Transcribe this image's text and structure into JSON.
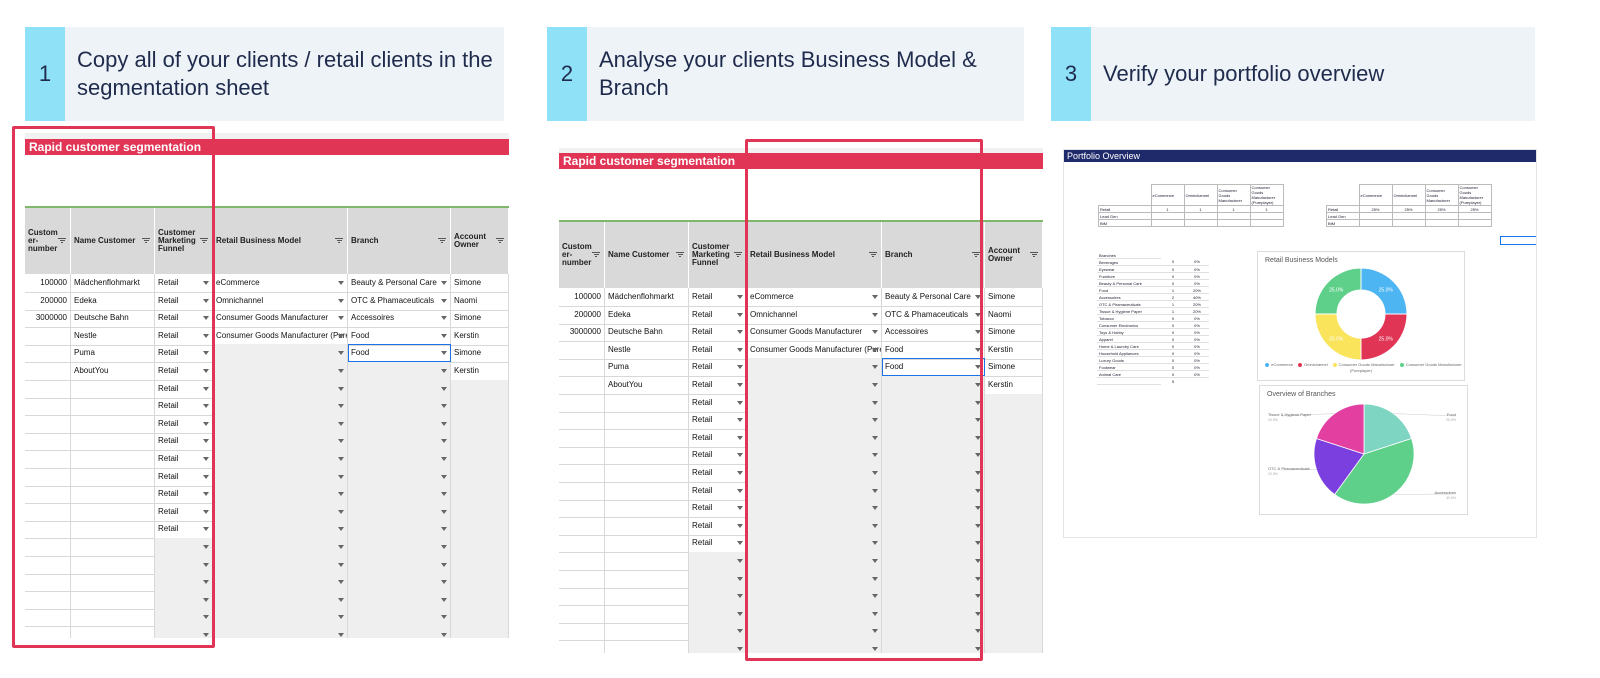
{
  "steps": [
    {
      "num": "1",
      "text": "Copy all of your clients / retail clients in the segmentation sheet"
    },
    {
      "num": "2",
      "text": "Analyse your clients Business Model & Branch"
    },
    {
      "num": "3",
      "text": "Verify your portfolio overview"
    }
  ],
  "sheet": {
    "title": "Rapid customer segmentation",
    "headers": [
      "Custom er- number",
      "Name Customer",
      "Customer Marketing Funnel",
      "Retail Business Model",
      "Branch",
      "Account Owner"
    ],
    "rows": [
      {
        "num": "100000",
        "name": "Mädchenflohmarkt",
        "funnel": "Retail",
        "model": "eCommerce",
        "branch": "Beauty & Personal Care",
        "owner": "Simone"
      },
      {
        "num": "200000",
        "name": "Edeka",
        "funnel": "Retail",
        "model": "Omnichannel",
        "branch": "OTC & Phamaceuticals",
        "owner": "Naomi"
      },
      {
        "num": "3000000",
        "name": "Deutsche  Bahn",
        "funnel": "Retail",
        "model": "Consumer Goods Manufacturer",
        "branch": "Accessoires",
        "owner": "Simone"
      },
      {
        "num": "",
        "name": "Nestle",
        "funnel": "Retail",
        "model": "Consumer Goods Manufacturer (Pureplayer)",
        "branch": "Food",
        "owner": "Kerstin"
      },
      {
        "num": "",
        "name": "Puma",
        "funnel": "Retail",
        "model": "",
        "branch": "Food",
        "owner": "Simone"
      },
      {
        "num": "",
        "name": "AboutYou",
        "funnel": "Retail",
        "model": "",
        "branch": "",
        "owner": "Kerstin"
      },
      {
        "num": "",
        "name": "",
        "funnel": "Retail",
        "model": "",
        "branch": "",
        "owner": ""
      },
      {
        "num": "",
        "name": "",
        "funnel": "Retail",
        "model": "",
        "branch": "",
        "owner": ""
      },
      {
        "num": "",
        "name": "",
        "funnel": "Retail",
        "model": "",
        "branch": "",
        "owner": ""
      },
      {
        "num": "",
        "name": "",
        "funnel": "Retail",
        "model": "",
        "branch": "",
        "owner": ""
      },
      {
        "num": "",
        "name": "",
        "funnel": "Retail",
        "model": "",
        "branch": "",
        "owner": ""
      },
      {
        "num": "",
        "name": "",
        "funnel": "Retail",
        "model": "",
        "branch": "",
        "owner": ""
      },
      {
        "num": "",
        "name": "",
        "funnel": "Retail",
        "model": "",
        "branch": "",
        "owner": ""
      },
      {
        "num": "",
        "name": "",
        "funnel": "Retail",
        "model": "",
        "branch": "",
        "owner": ""
      },
      {
        "num": "",
        "name": "",
        "funnel": "Retail",
        "model": "",
        "branch": "",
        "owner": ""
      },
      {
        "num": "",
        "name": "",
        "funnel": "",
        "model": "",
        "branch": "",
        "owner": ""
      },
      {
        "num": "",
        "name": "",
        "funnel": "",
        "model": "",
        "branch": "",
        "owner": ""
      },
      {
        "num": "",
        "name": "",
        "funnel": "",
        "model": "",
        "branch": "",
        "owner": ""
      },
      {
        "num": "",
        "name": "",
        "funnel": "",
        "model": "",
        "branch": "",
        "owner": ""
      },
      {
        "num": "",
        "name": "",
        "funnel": "",
        "model": "",
        "branch": "",
        "owner": ""
      },
      {
        "num": "",
        "name": "",
        "funnel": "",
        "model": "",
        "branch": "",
        "owner": ""
      }
    ]
  },
  "portfolio": {
    "title": "Portfolio Overview",
    "matrix_cols": [
      "eCommerce",
      "Omnichannel",
      "Consumer Goods Manufacturer",
      "Consumer Goods Manufacturer (Pureplayer)"
    ],
    "matrix_rows": [
      "Retail",
      "Lead Gen",
      "BtM"
    ],
    "counts": [
      "1",
      "1",
      "1",
      "1"
    ],
    "percents": [
      "25%",
      "25%",
      "25%",
      "25%"
    ],
    "branches_title": "Branches",
    "branches": [
      [
        "Beverages",
        "0",
        "0%"
      ],
      [
        "Eyewear",
        "0",
        "0%"
      ],
      [
        "Furniture",
        "0",
        "0%"
      ],
      [
        "Beauty & Personal Care",
        "0",
        "0%"
      ],
      [
        "Food",
        "1",
        "20%"
      ],
      [
        "Accessoires",
        "2",
        "40%"
      ],
      [
        "OTC & Phamaceuticals",
        "1",
        "20%"
      ],
      [
        "Tissue & Hygiene Paper",
        "1",
        "20%"
      ],
      [
        "Tobacco",
        "0",
        "0%"
      ],
      [
        "Consumer Electronics",
        "0",
        "0%"
      ],
      [
        "Toys & Hobby",
        "0",
        "0%"
      ],
      [
        "Apparel",
        "0",
        "0%"
      ],
      [
        "Home & Laundry Care",
        "0",
        "0%"
      ],
      [
        "Household Appliances",
        "0",
        "0%"
      ],
      [
        "Luxury Goods",
        "0",
        "0%"
      ],
      [
        "Footwear",
        "0",
        "0%"
      ],
      [
        "Animal Care",
        "0",
        "0%"
      ]
    ],
    "branches_total": "5",
    "donut": {
      "title": "Retail Business Models",
      "slices": [
        {
          "label": "eCommerce",
          "value": 25.0,
          "text": "25.0%",
          "color": "#4db6f2"
        },
        {
          "label": "Omnichannel",
          "value": 25.0,
          "text": "25.0%",
          "color": "#e03555"
        },
        {
          "label": "Consumer Goods Manufacturer",
          "value": 25.0,
          "text": "25.0%",
          "color": "#f9e45b"
        },
        {
          "label": "Consumer Goods Manufacturer (Pureplayer)",
          "value": 25.0,
          "text": "25.0%",
          "color": "#5ed089"
        }
      ]
    },
    "pie": {
      "title": "Overview of Branches",
      "slices": [
        {
          "label": "Food",
          "value": 20,
          "text": "20.0%",
          "color": "#7ed6c2"
        },
        {
          "label": "Accessoires",
          "value": 40,
          "text": "40.0%",
          "color": "#5ed089"
        },
        {
          "label": "OTC & Phamaceuticals",
          "value": 20,
          "text": "20.0%",
          "color": "#7b3fe0"
        },
        {
          "label": "Tissue & Hygiene Paper",
          "value": 20,
          "text": "20.0%",
          "color": "#e23fa1"
        }
      ]
    }
  }
}
